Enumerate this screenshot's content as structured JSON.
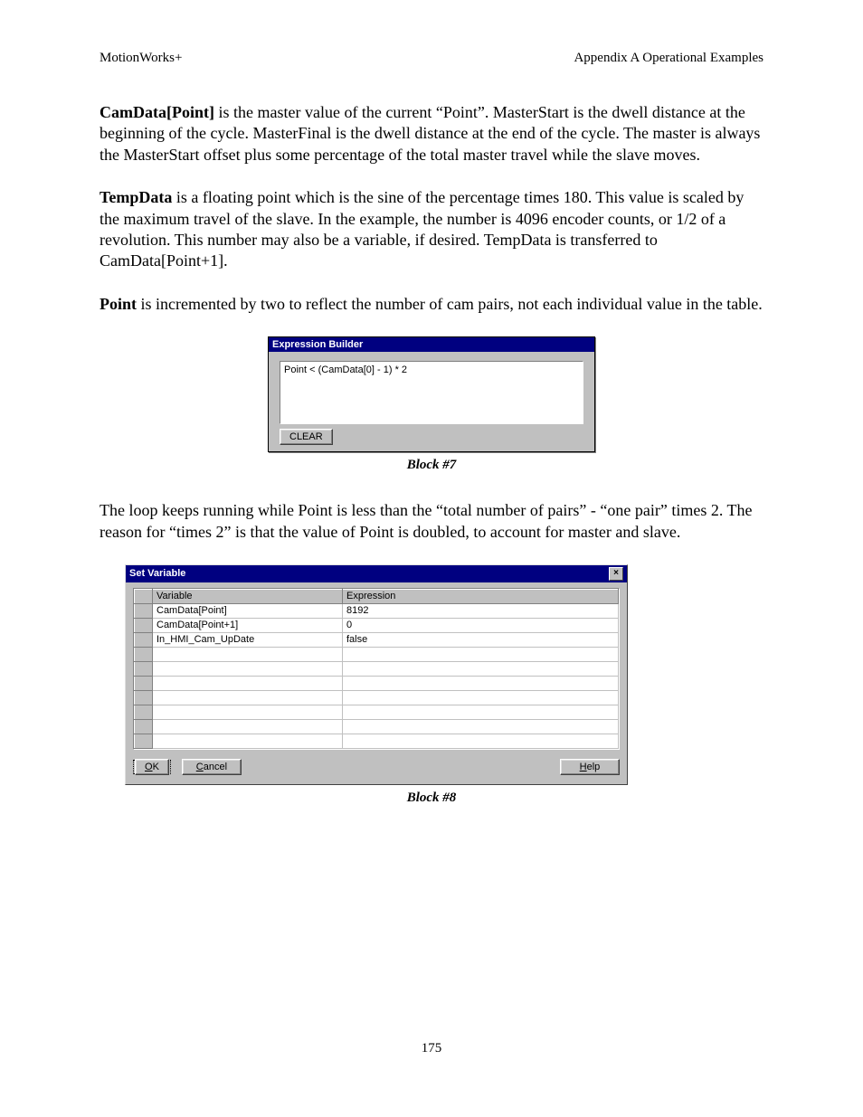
{
  "header": {
    "left": "MotionWorks+",
    "right": "Appendix A    Operational Examples"
  },
  "para1": {
    "bold": "CamData[Point]",
    "rest": " is the master value of the current “Point”.  MasterStart is the dwell distance at the beginning of the cycle.  MasterFinal is the dwell distance at the end of the cycle.  The master is always the MasterStart offset plus some percentage of the total master travel while the slave moves."
  },
  "para2": {
    "bold": "TempData",
    "rest": " is a floating point which is the sine of the percentage times 180.  This value is scaled by the maximum travel of the slave.  In the example, the number is 4096 encoder counts, or 1/2 of a revolution.  This number may also be a variable, if desired.  TempData is transferred to CamData[Point+1]."
  },
  "para3": {
    "bold": "Point",
    "rest": " is incremented by two to reflect the number of cam pairs, not each individual value in the table."
  },
  "dlg1": {
    "title": "Expression Builder",
    "expression": "Point < (CamData[0] - 1) * 2",
    "clear": "CLEAR"
  },
  "caption1": "Block #7",
  "para4": "The loop keeps running while Point is less than the “total number of pairs” - “one pair” times 2.  The reason for “times 2” is that the value of Point is doubled, to account for master and slave.",
  "dlg2": {
    "title": "Set Variable",
    "col_variable": "Variable",
    "col_expression": "Expression",
    "rows": [
      {
        "variable": "CamData[Point]",
        "expression": "8192"
      },
      {
        "variable": "CamData[Point+1]",
        "expression": "0"
      },
      {
        "variable": "In_HMI_Cam_UpDate",
        "expression": "false"
      }
    ],
    "ok": "OK",
    "cancel": "Cancel",
    "help": "Help"
  },
  "caption2": "Block #8",
  "page_number": "175"
}
